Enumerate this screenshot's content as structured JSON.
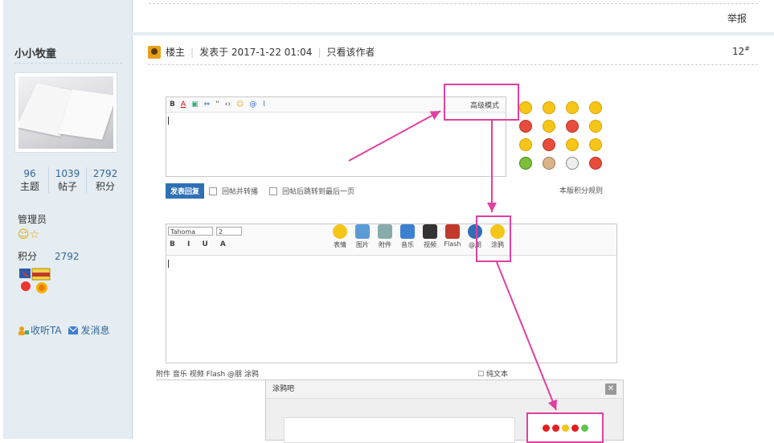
{
  "top": {
    "report_label": "举报"
  },
  "author": {
    "username": "小小牧童",
    "stats": [
      {
        "value": "96",
        "label": "主题"
      },
      {
        "value": "1039",
        "label": "帖子"
      },
      {
        "value": "2792",
        "label": "积分"
      }
    ],
    "group": "管理员",
    "points_label": "积分",
    "points_value": "2792",
    "follow_label": "收听TA",
    "message_label": "发消息"
  },
  "post": {
    "owner_label": "楼主",
    "posted_at": "发表于 2017-1-22 01:04",
    "only_author_label": "只看该作者",
    "floor": "12",
    "floor_sup": "#"
  },
  "screenshot": {
    "advanced_mode": "高级模式",
    "reply_button": "发表回复",
    "option_1": "回帖并转播",
    "option_2": "回帖后跳转到最后一页",
    "rules_link": "本版积分规则",
    "font_name": "Tahoma",
    "font_size": "2",
    "tool_labels": [
      "表情",
      "图片",
      "附件",
      "音乐",
      "视频",
      "Flash",
      "@朋",
      "涂鸦"
    ],
    "mini_bar_text": "附件  音乐  视频  Flash  @朋  涂鸦",
    "pure_text": "纯文本",
    "doodle_title": "涂鸦吧",
    "doodle_close": "✕"
  },
  "colors": {
    "highlight": "#e040a0",
    "link": "#336699",
    "sidebar_bg": "#e5edf2"
  }
}
